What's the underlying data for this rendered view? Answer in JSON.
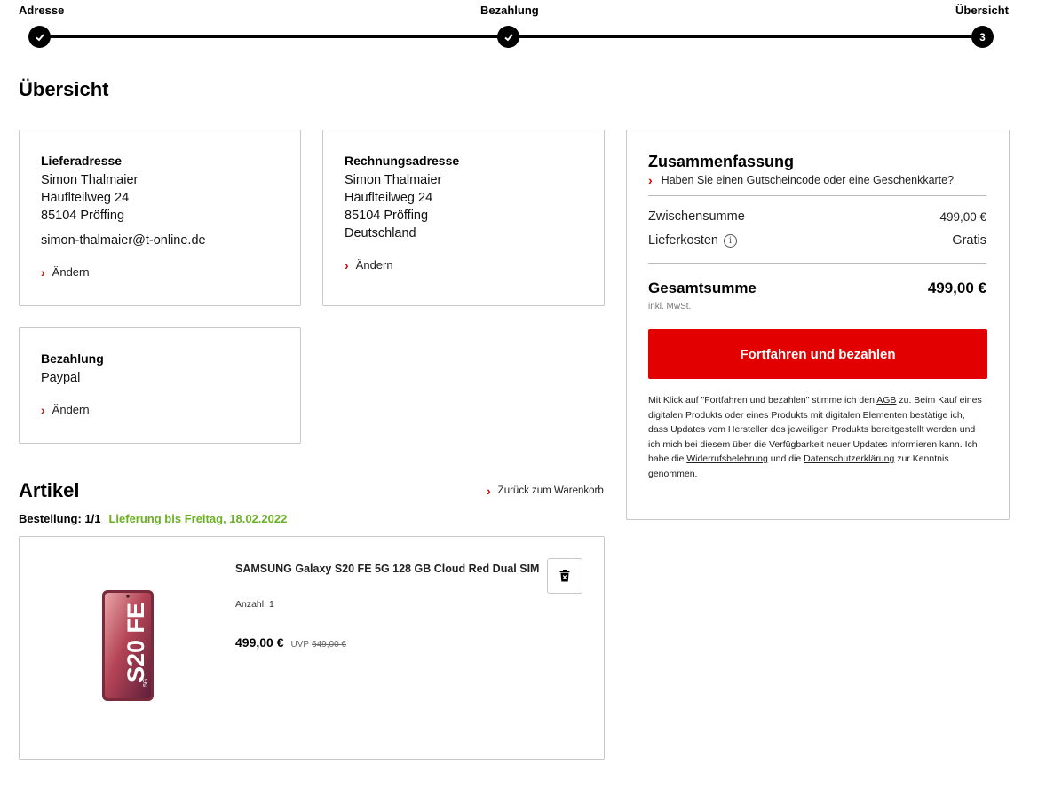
{
  "stepper": {
    "steps": [
      {
        "label": "Adresse",
        "marker": "check-icon"
      },
      {
        "label": "Bezahlung",
        "marker": "check-icon"
      },
      {
        "label": "Übersicht",
        "marker": "3"
      }
    ]
  },
  "page": {
    "title": "Übersicht"
  },
  "delivery_address": {
    "title": "Lieferadresse",
    "name": "Simon Thalmaier",
    "street": "Häuflteilweg 24",
    "city": "85104 Pröffing",
    "email": "simon-thalmaier@t-online.de",
    "change_label": "Ändern"
  },
  "billing_address": {
    "title": "Rechnungsadresse",
    "name": "Simon Thalmaier",
    "street": "Häuflteilweg 24",
    "city": "85104 Pröffing",
    "country": "Deutschland",
    "change_label": "Ändern"
  },
  "payment": {
    "title": "Bezahlung",
    "method": "Paypal",
    "change_label": "Ändern"
  },
  "articles": {
    "title": "Artikel",
    "back_link": "Zurück zum Warenkorb",
    "order_label": "Bestellung: 1/1",
    "delivery_info": "Lieferung bis Freitag, 18.02.2022",
    "item": {
      "name": "SAMSUNG Galaxy S20 FE 5G 128 GB Cloud Red Dual SIM",
      "quantity": "Anzahl: 1",
      "price": "499,00 €",
      "uvp_label": "UVP",
      "uvp_price": "649,00 €",
      "image_text": "S20 FE",
      "image_badge": "5G"
    }
  },
  "summary": {
    "title": "Zusammenfassung",
    "voucher_link": "Haben Sie einen Gutscheincode oder eine Geschenkkarte?",
    "subtotal_label": "Zwischensumme",
    "subtotal_value": "499,00 €",
    "shipping_label": "Lieferkosten",
    "shipping_value": "Gratis",
    "total_label": "Gesamtsumme",
    "total_value": "499,00 €",
    "vat_note": "inkl. MwSt.",
    "pay_button": "Fortfahren und bezahlen",
    "legal": {
      "p1": "Mit Klick auf \"Fortfahren und bezahlen\" stimme ich den ",
      "agb": "AGB",
      "p2": " zu. Beim Kauf eines digitalen Produkts oder eines Produkts mit digitalen Elementen bestätige ich, dass Updates vom Hersteller des jeweiligen Produkts bereitgestellt werden und ich mich bei diesem über die Verfügbarkeit neuer Updates informieren kann. Ich habe die ",
      "widerruf": "Widerrufsbelehrung",
      "p3": " und die ",
      "datenschutz": "Datenschutzerklärung",
      "p4": " zur Kenntnis genommen."
    }
  },
  "colors": {
    "accent": "#e20000",
    "delivery_green": "#6ab023",
    "border": "#c8c8c8"
  }
}
